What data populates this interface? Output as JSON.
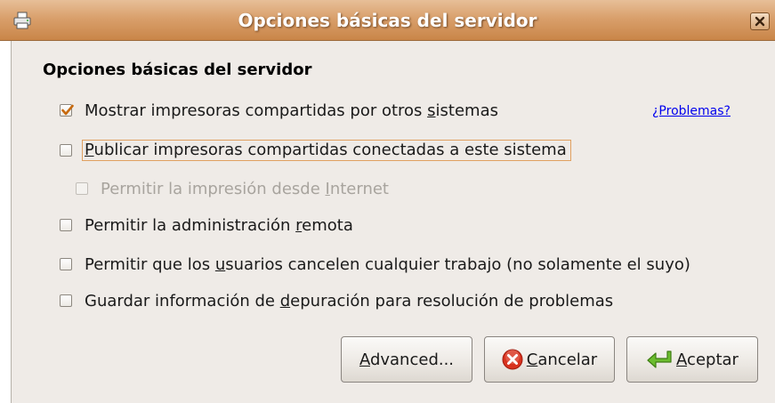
{
  "window": {
    "title": "Opciones básicas del servidor"
  },
  "section": {
    "heading": "Opciones básicas del servidor"
  },
  "options": [
    {
      "pre": "Mostrar impresoras compartidas por otros ",
      "u": "s",
      "post": "istemas",
      "checked": true,
      "enabled": true
    },
    {
      "pre": "",
      "u": "P",
      "post": "ublicar impresoras compartidas conectadas a este sistema",
      "checked": false,
      "enabled": true,
      "focused": true
    },
    {
      "pre": "Permitir la impresión desde ",
      "u": "I",
      "post": "nternet",
      "checked": false,
      "enabled": false
    },
    {
      "pre": "Permitir la administración ",
      "u": "r",
      "post": "emota",
      "checked": false,
      "enabled": true
    },
    {
      "pre": "Permitir que los ",
      "u": "u",
      "post": "suarios cancelen cualquier trabajo (no solamente el suyo)",
      "checked": false,
      "enabled": true
    },
    {
      "pre": "Guardar información de ",
      "u": "d",
      "post": "epuración para resolución de problemas",
      "checked": false,
      "enabled": true
    }
  ],
  "problems_link": "¿Problemas?",
  "buttons": {
    "advanced": {
      "u": "A",
      "post": "dvanced..."
    },
    "cancel": {
      "u": "C",
      "post": "ancelar"
    },
    "accept": {
      "u": "A",
      "post": "ceptar"
    }
  },
  "icons": {
    "window": "printer-icon",
    "close": "close-icon",
    "cancel": "cancel-icon",
    "accept": "enter-arrow-icon"
  },
  "colors": {
    "titlebar": "#d9a06c",
    "focus": "#e0a060",
    "link": "#0000ee",
    "check": "#c76a10"
  }
}
